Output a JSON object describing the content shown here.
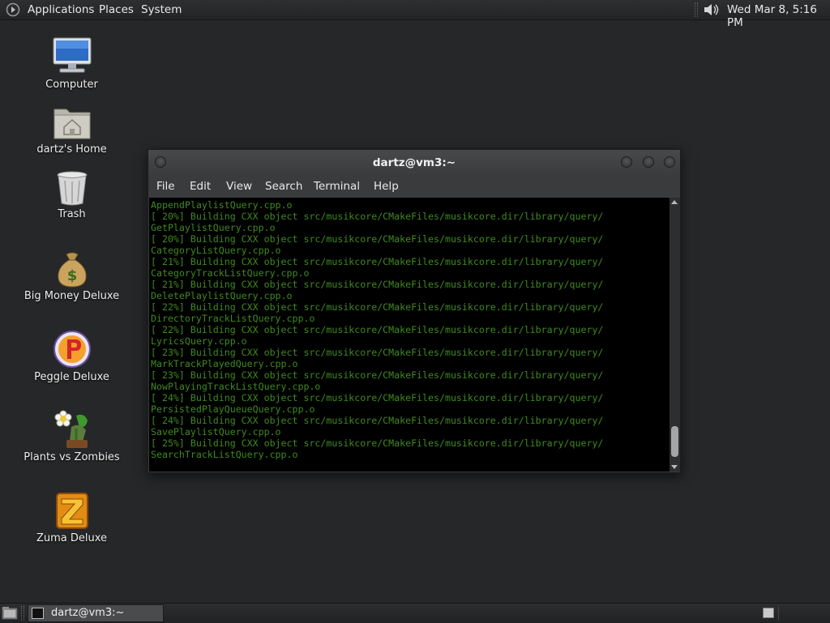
{
  "top_panel": {
    "menus": [
      "Applications",
      "Places",
      "System"
    ],
    "clock": "Wed Mar  8,  5:16 PM",
    "volume_icon": "speaker-icon"
  },
  "desktop_icons": [
    {
      "label": "Computer",
      "icon": "computer-icon"
    },
    {
      "label": "dartz's Home",
      "icon": "home-folder-icon"
    },
    {
      "label": "Trash",
      "icon": "trash-icon"
    },
    {
      "label": "Big Money Deluxe",
      "icon": "money-bag-icon"
    },
    {
      "label": "Peggle Deluxe",
      "icon": "peggle-icon"
    },
    {
      "label": "Plants vs Zombies",
      "icon": "plants-vs-zombies-icon"
    },
    {
      "label": "Zuma Deluxe",
      "icon": "zuma-icon"
    }
  ],
  "terminal": {
    "title": "dartz@vm3:~",
    "menus": [
      "File",
      "Edit",
      "View",
      "Search",
      "Terminal",
      "Help"
    ],
    "output_color": "#3f8a1f",
    "lines": [
      "AppendPlaylistQuery.cpp.o",
      "[ 20%] Building CXX object src/musikcore/CMakeFiles/musikcore.dir/library/query/",
      "GetPlaylistQuery.cpp.o",
      "[ 20%] Building CXX object src/musikcore/CMakeFiles/musikcore.dir/library/query/",
      "CategoryListQuery.cpp.o",
      "[ 21%] Building CXX object src/musikcore/CMakeFiles/musikcore.dir/library/query/",
      "CategoryTrackListQuery.cpp.o",
      "[ 21%] Building CXX object src/musikcore/CMakeFiles/musikcore.dir/library/query/",
      "DeletePlaylistQuery.cpp.o",
      "[ 22%] Building CXX object src/musikcore/CMakeFiles/musikcore.dir/library/query/",
      "DirectoryTrackListQuery.cpp.o",
      "[ 22%] Building CXX object src/musikcore/CMakeFiles/musikcore.dir/library/query/",
      "LyricsQuery.cpp.o",
      "[ 23%] Building CXX object src/musikcore/CMakeFiles/musikcore.dir/library/query/",
      "MarkTrackPlayedQuery.cpp.o",
      "[ 23%] Building CXX object src/musikcore/CMakeFiles/musikcore.dir/library/query/",
      "NowPlayingTrackListQuery.cpp.o",
      "[ 24%] Building CXX object src/musikcore/CMakeFiles/musikcore.dir/library/query/",
      "PersistedPlayQueueQuery.cpp.o",
      "[ 24%] Building CXX object src/musikcore/CMakeFiles/musikcore.dir/library/query/",
      "SavePlaylistQuery.cpp.o",
      "[ 25%] Building CXX object src/musikcore/CMakeFiles/musikcore.dir/library/query/",
      "SearchTrackListQuery.cpp.o"
    ]
  },
  "taskbar": {
    "window_button_label": "dartz@vm3:~"
  }
}
